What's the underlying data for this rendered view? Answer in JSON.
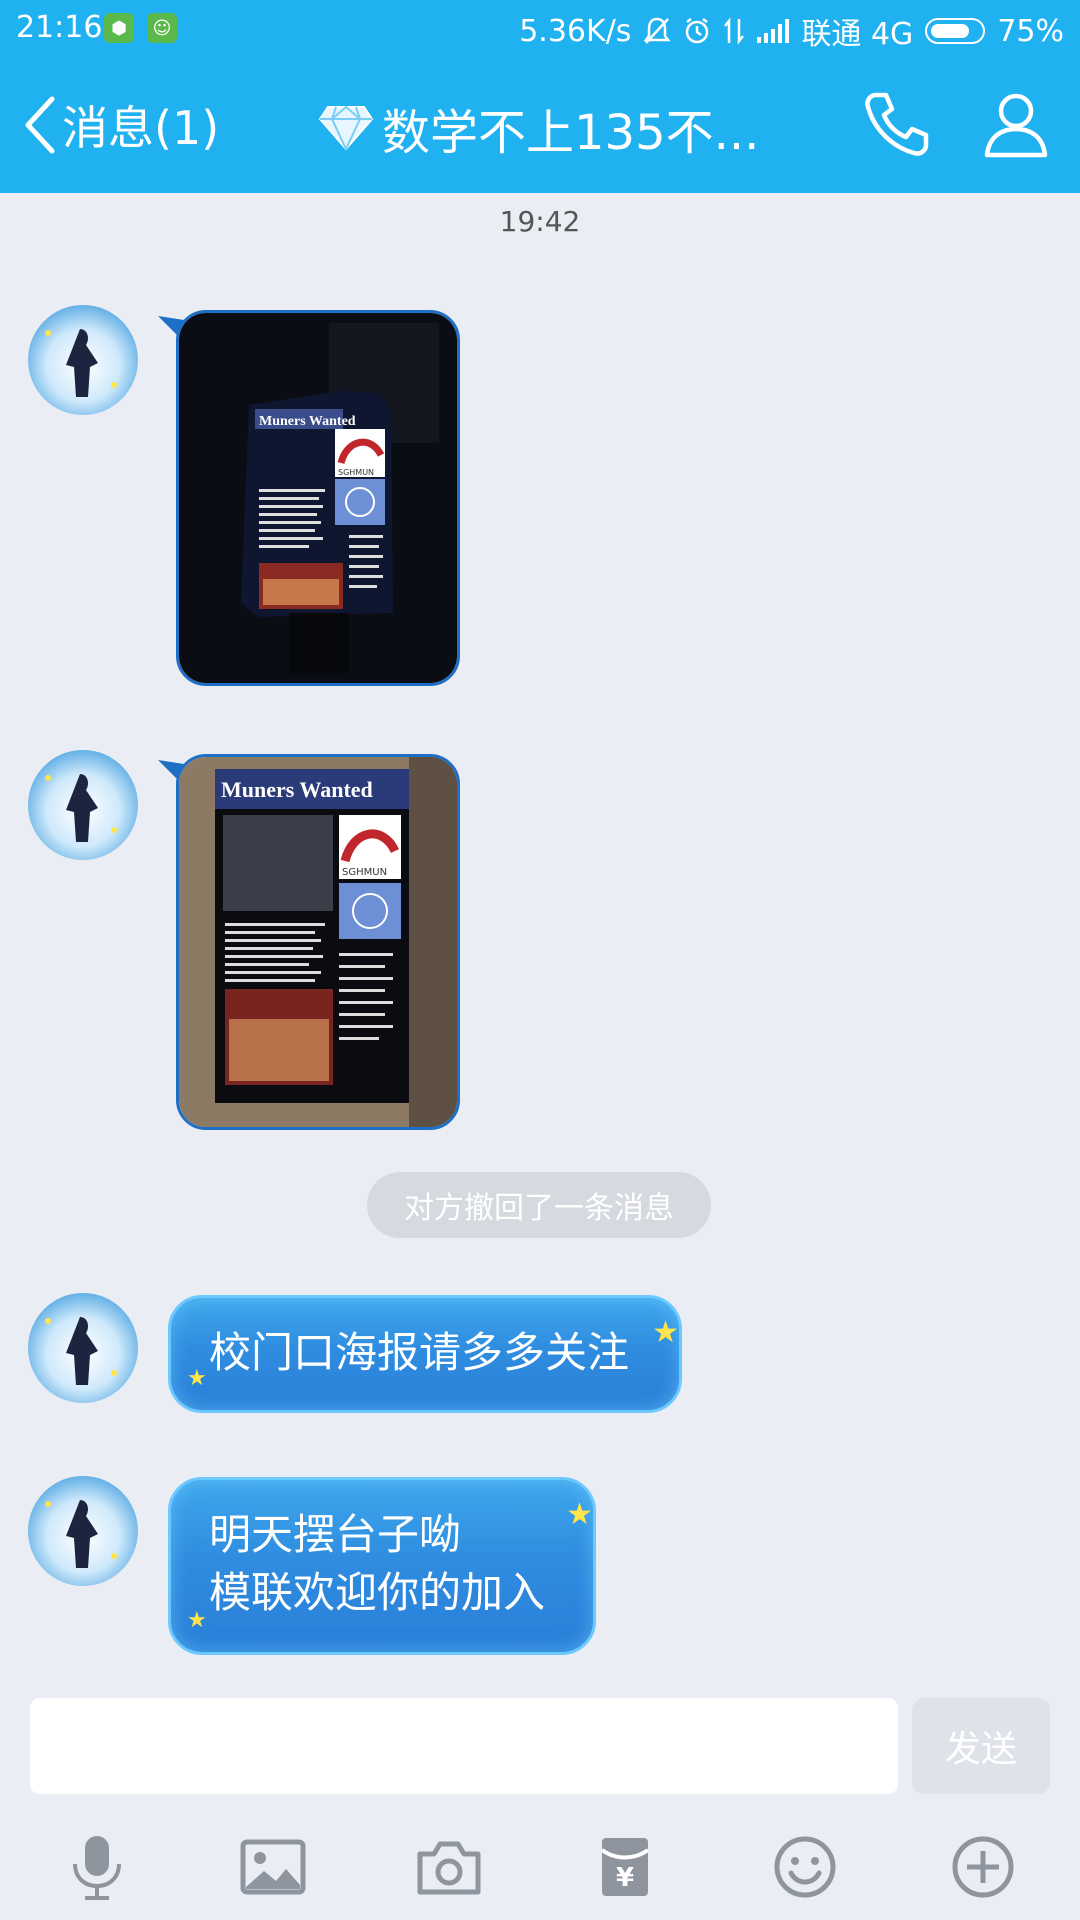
{
  "status_bar": {
    "time": "21:16",
    "network_speed": "5.36K/s",
    "carrier": "联通 4G",
    "battery": "75%"
  },
  "header": {
    "back_label": "消息(1)",
    "title": "数学不上135不..."
  },
  "messages": {
    "timestamp": "19:42",
    "recall_notice": "对方撤回了一条消息",
    "text_1": "校门口海报请多多关注",
    "text_2_line_1": "明天摆台子呦",
    "text_2_line_2": "模联欢迎你的加入"
  },
  "poster": {
    "headline": "Muners Wanted",
    "logo_text": "SGHMUN"
  },
  "input": {
    "value": "",
    "send_label": "发送"
  },
  "toolbar": {
    "items": [
      "microphone-icon",
      "image-icon",
      "camera-icon",
      "red-packet-icon",
      "emoji-icon",
      "plus-icon"
    ]
  },
  "colors": {
    "brand_blue": "#20b1f0",
    "bubble_blue": "#2f8de0",
    "background": "#eaedf4"
  }
}
